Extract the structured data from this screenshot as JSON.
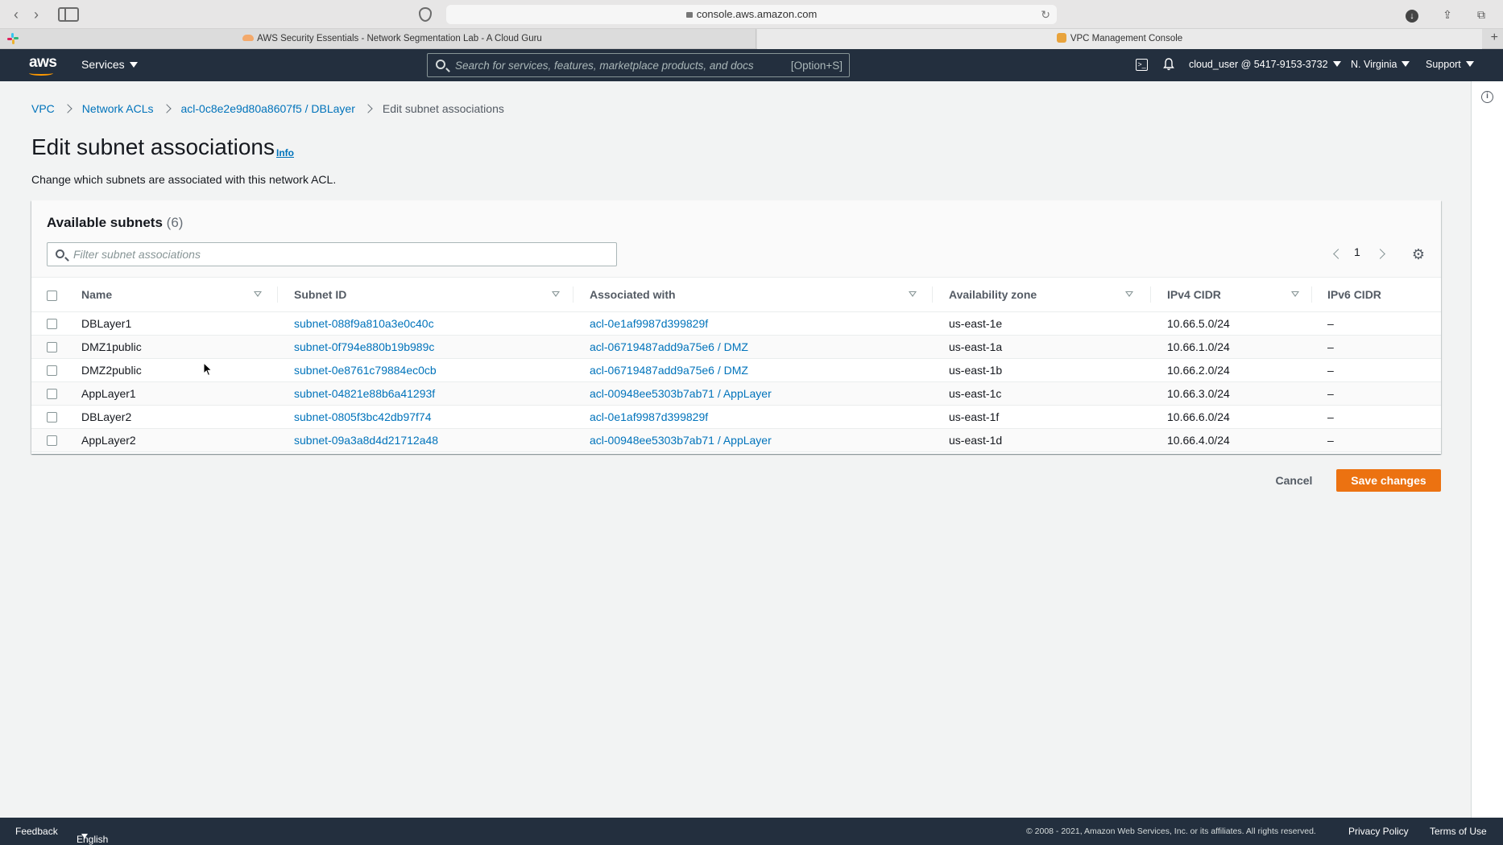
{
  "browser": {
    "url": "console.aws.amazon.com",
    "tabs": [
      {
        "label": "AWS Security Essentials - Network Segmentation Lab - A Cloud Guru"
      },
      {
        "label": "VPC Management Console"
      }
    ]
  },
  "header": {
    "logo": "aws",
    "services_label": "Services",
    "search_placeholder": "Search for services, features, marketplace products, and docs",
    "search_shortcut": "[Option+S]",
    "account": "cloud_user @ 5417-9153-3732",
    "region": "N. Virginia",
    "support": "Support"
  },
  "breadcrumb": {
    "items": [
      "VPC",
      "Network ACLs",
      "acl-0c8e2e9d80a8607f5 / DBLayer"
    ],
    "current": "Edit subnet associations"
  },
  "page": {
    "title": "Edit subnet associations",
    "info_label": "Info",
    "description": "Change which subnets are associated with this network ACL."
  },
  "panel": {
    "title": "Available subnets",
    "count": "(6)",
    "filter_placeholder": "Filter subnet associations",
    "page_number": "1"
  },
  "table": {
    "columns": [
      "Name",
      "Subnet ID",
      "Associated with",
      "Availability zone",
      "IPv4 CIDR",
      "IPv6 CIDR"
    ],
    "rows": [
      {
        "name": "DBLayer1",
        "subnet_id": "subnet-088f9a810a3e0c40c",
        "associated_with": "acl-0e1af9987d399829f",
        "az": "us-east-1e",
        "ipv4": "10.66.5.0/24",
        "ipv6": "–"
      },
      {
        "name": "DMZ1public",
        "subnet_id": "subnet-0f794e880b19b989c",
        "associated_with": "acl-06719487add9a75e6 / DMZ",
        "az": "us-east-1a",
        "ipv4": "10.66.1.0/24",
        "ipv6": "–"
      },
      {
        "name": "DMZ2public",
        "subnet_id": "subnet-0e8761c79884ec0cb",
        "associated_with": "acl-06719487add9a75e6 / DMZ",
        "az": "us-east-1b",
        "ipv4": "10.66.2.0/24",
        "ipv6": "–"
      },
      {
        "name": "AppLayer1",
        "subnet_id": "subnet-04821e88b6a41293f",
        "associated_with": "acl-00948ee5303b7ab71 / AppLayer",
        "az": "us-east-1c",
        "ipv4": "10.66.3.0/24",
        "ipv6": "–"
      },
      {
        "name": "DBLayer2",
        "subnet_id": "subnet-0805f3bc42db97f74",
        "associated_with": "acl-0e1af9987d399829f",
        "az": "us-east-1f",
        "ipv4": "10.66.6.0/24",
        "ipv6": "–"
      },
      {
        "name": "AppLayer2",
        "subnet_id": "subnet-09a3a8d4d21712a48",
        "associated_with": "acl-00948ee5303b7ab71 / AppLayer",
        "az": "us-east-1d",
        "ipv4": "10.66.4.0/24",
        "ipv6": "–"
      }
    ]
  },
  "actions": {
    "cancel": "Cancel",
    "save": "Save changes"
  },
  "footer": {
    "feedback": "Feedback",
    "language": "English (US)",
    "copyright": "© 2008 - 2021, Amazon Web Services, Inc. or its affiliates. All rights reserved.",
    "privacy": "Privacy Policy",
    "terms": "Terms of Use"
  },
  "colors": {
    "header_bg": "#232f3e",
    "link": "#0073bb",
    "primary_button": "#ec7211"
  }
}
